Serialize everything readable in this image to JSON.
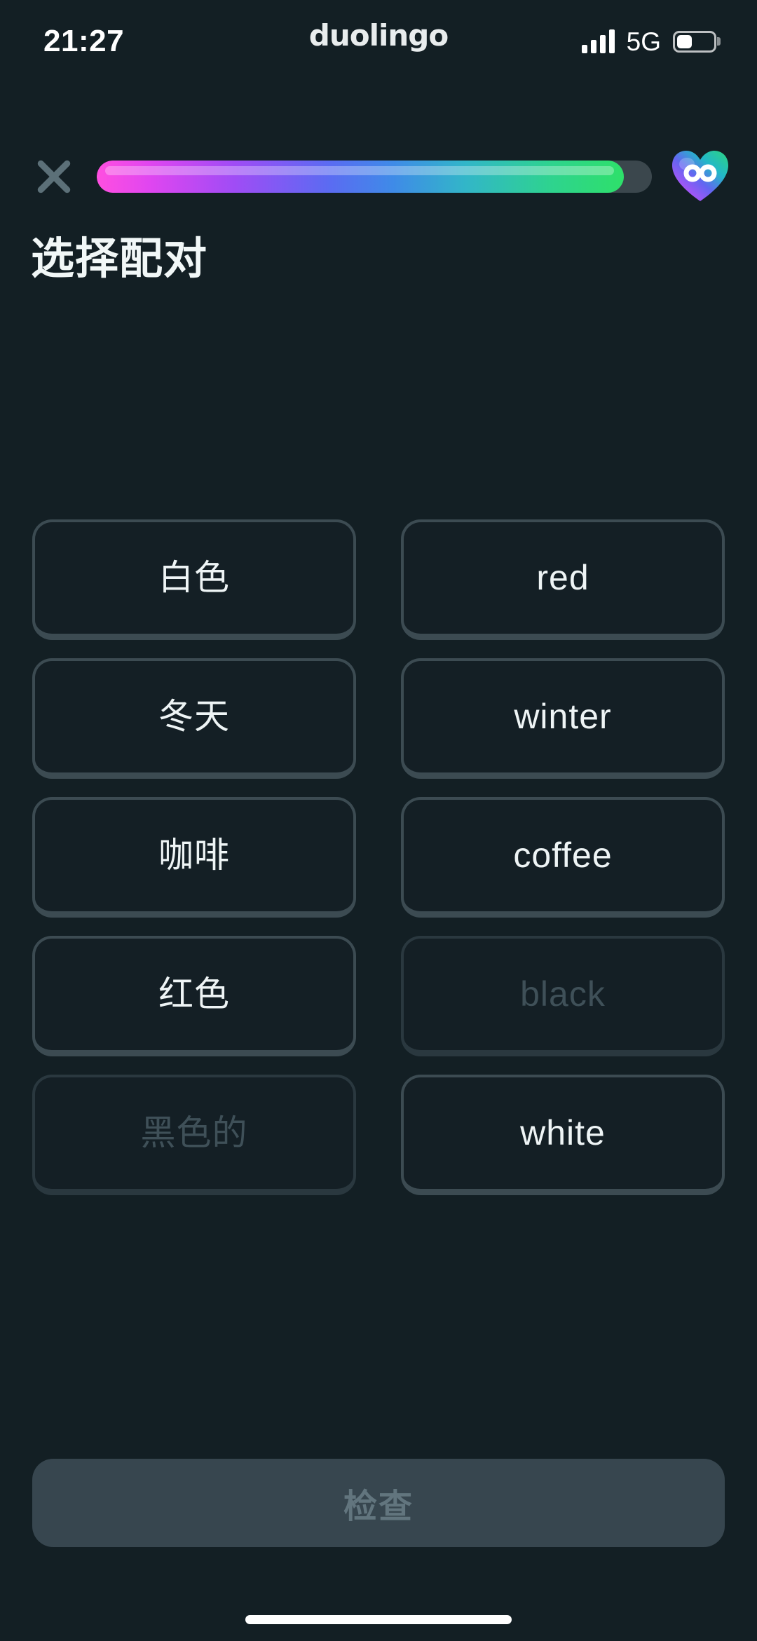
{
  "status_bar": {
    "time": "21:27",
    "brand": "duolingo",
    "network": "5G",
    "signal_icon": "signal-bars-icon",
    "battery_icon": "battery-icon",
    "battery_level_percent": 42
  },
  "header": {
    "close_icon": "close-x-icon",
    "progress_percent": 95,
    "progress_colors": {
      "start": "#ff4fe0",
      "mid": "#5b6bf2",
      "end": "#2ee06a",
      "track": "#3b474d"
    },
    "hearts_badge": {
      "icon": "heart-infinity-icon",
      "symbol": "∞",
      "gradient_start": "#a855f7",
      "gradient_end": "#2dd4a7"
    }
  },
  "exercise": {
    "prompt": "选择配对",
    "tiles": [
      {
        "id": "t1",
        "text": "白色",
        "column": "left",
        "state": "default"
      },
      {
        "id": "t2",
        "text": "red",
        "column": "right",
        "state": "default"
      },
      {
        "id": "t3",
        "text": "冬天",
        "column": "left",
        "state": "default"
      },
      {
        "id": "t4",
        "text": "winter",
        "column": "right",
        "state": "default"
      },
      {
        "id": "t5",
        "text": "咖啡",
        "column": "left",
        "state": "default"
      },
      {
        "id": "t6",
        "text": "coffee",
        "column": "right",
        "state": "default"
      },
      {
        "id": "t7",
        "text": "红色",
        "column": "left",
        "state": "default"
      },
      {
        "id": "t8",
        "text": "black",
        "column": "right",
        "state": "matched"
      },
      {
        "id": "t9",
        "text": "黑色的",
        "column": "left",
        "state": "matched"
      },
      {
        "id": "t10",
        "text": "white",
        "column": "right",
        "state": "default"
      }
    ]
  },
  "footer": {
    "check_label": "检查",
    "check_enabled": false
  }
}
